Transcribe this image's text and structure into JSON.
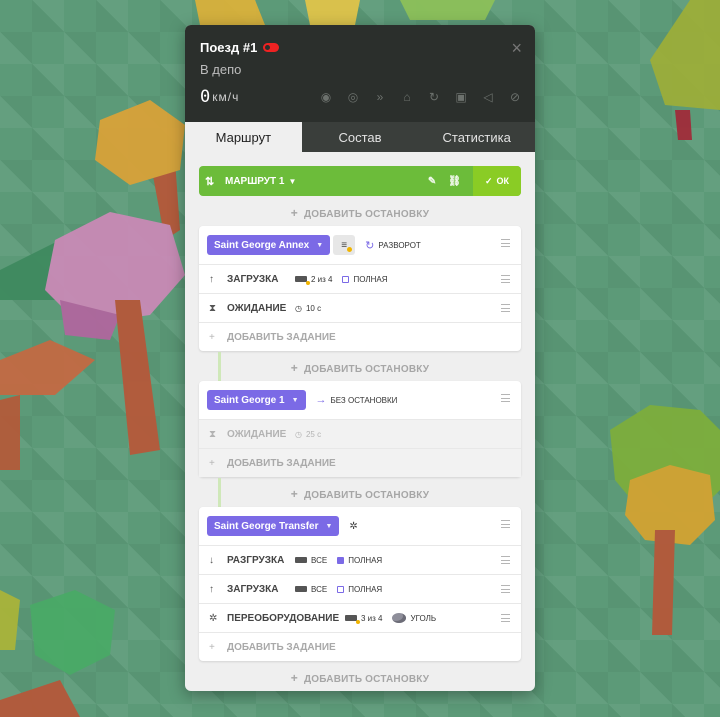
{
  "train": {
    "title": "Поезд #1",
    "status": "В депо",
    "speed": "0",
    "speed_unit": "км/ч",
    "close_icon": "close-icon",
    "header_icons": [
      "target-icon",
      "eye-icon",
      "forward-icon",
      "depot-icon",
      "refresh-icon",
      "lock-icon",
      "horn-icon",
      "mute-icon"
    ]
  },
  "tabs": [
    "Маршрут",
    "Состав",
    "Статистика"
  ],
  "route": {
    "name": "МАРШРУТ 1",
    "ok_label": "ОК",
    "add_stop_label": "ДОБАВИТЬ ОСТАНОВКУ",
    "stops": [
      {
        "station": "Saint George Annex",
        "option_label": "РАЗВОРОТ",
        "tasks": [
          {
            "label": "ЗАГРУЗКА",
            "amount": "2 из 4",
            "checkbox_label": "ПОЛНАЯ",
            "checked": false
          },
          {
            "label": "ОЖИДАНИЕ",
            "time": "10 с"
          }
        ],
        "add_task_label": "ДОБАВИТЬ ЗАДАНИЕ"
      },
      {
        "station": "Saint George 1",
        "option_label": "БЕЗ ОСТАНОВКИ",
        "tasks": [
          {
            "label": "ОЖИДАНИЕ",
            "time": "25 с"
          }
        ],
        "add_task_label": "ДОБАВИТЬ ЗАДАНИЕ"
      },
      {
        "station": "Saint George Transfer",
        "option_label": "",
        "tasks": [
          {
            "label": "РАЗГРУЗКА",
            "amount": "ВСЕ",
            "checkbox_label": "ПОЛНАЯ",
            "checked": true
          },
          {
            "label": "ЗАГРУЗКА",
            "amount": "ВСЕ",
            "checkbox_label": "ПОЛНАЯ",
            "checked": false
          },
          {
            "label": "ПЕРЕОБОРУДОВАНИЕ",
            "amount": "3 из 4",
            "cargo_label": "УГОЛЬ"
          }
        ],
        "add_task_label": "ДОБАВИТЬ ЗАДАНИЕ"
      }
    ]
  },
  "colors": {
    "header_bg": "#2b2f2c",
    "route_green": "#6cbc3a",
    "ok_green": "#8acc25",
    "station_purple": "#7b6ae6",
    "toggle_red": "#e22222"
  }
}
